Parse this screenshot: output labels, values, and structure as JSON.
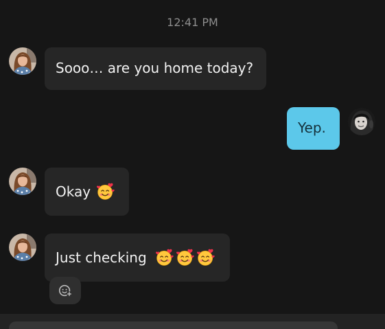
{
  "chat": {
    "timestamp": "12:41 PM",
    "messages": [
      {
        "sender": "other",
        "text": "Sooo… are you home today?",
        "emoji_count": 0
      },
      {
        "sender": "me",
        "text": "Yep.",
        "emoji_count": 0
      },
      {
        "sender": "other",
        "text": "Okay",
        "emoji_count": 1
      },
      {
        "sender": "other",
        "text": "Just checking",
        "emoji_count": 3
      }
    ]
  },
  "icons": {
    "emoji": "smiling-face-with-hearts-icon",
    "reaction": "add-reaction-icon"
  },
  "colors": {
    "background": "#161616",
    "incoming_bubble": "#262626",
    "outgoing_bubble": "#5cc8ea",
    "timestamp_text": "#8e8e8e"
  }
}
